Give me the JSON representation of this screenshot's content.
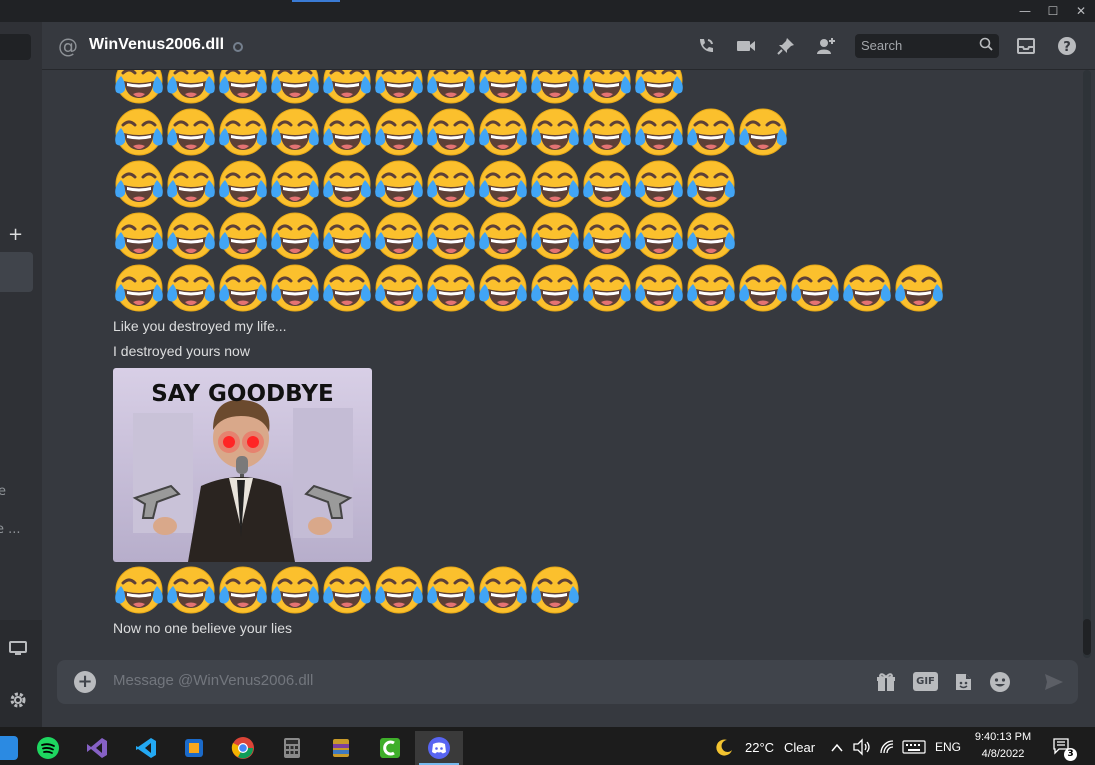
{
  "window": {
    "minimize": "—",
    "maximize": "☐",
    "close": "✕"
  },
  "sidebar": {
    "add_icon": "+",
    "partial_text_1": "e",
    "partial_text_2": "e ...",
    "screen_icon": "screen-share-icon",
    "settings_icon": "gear-icon"
  },
  "header": {
    "at_symbol": "@",
    "channel_name": "WinVenus2006.dll",
    "status": "offline",
    "search_placeholder": "Search",
    "icons": [
      "call-icon",
      "video-icon",
      "pin-icon",
      "add-friend-icon",
      "inbox-icon",
      "help-icon"
    ]
  },
  "messages": {
    "partial_top_row_count": 11,
    "row1_count": 13,
    "row2_count": 12,
    "row3_count": 12,
    "row4_count": 16,
    "text1": "Like you destroyed my life...",
    "text2": "I destroyed yours now",
    "meme_caption": "SAY GOODBYE",
    "row5_count": 9,
    "text3": "Now no one believe your lies",
    "emoji": "face-with-tears-of-joy"
  },
  "composer": {
    "placeholder": "Message @WinVenus2006.dll",
    "gif_label": "GIF",
    "icons": [
      "add-attachment-icon",
      "gift-icon",
      "gif-icon",
      "sticker-icon",
      "emoji-icon",
      "send-icon"
    ]
  },
  "taskbar": {
    "apps": [
      "start",
      "spotify",
      "visual-studio",
      "vs-code",
      "virtualbox",
      "chrome",
      "calculator",
      "winrar",
      "camtasia",
      "discord"
    ],
    "weather_temp": "22°C",
    "weather_desc": "Clear",
    "language": "ENG",
    "time": "9:40:13 PM",
    "date": "4/8/2022",
    "notification_count": "3",
    "colors": {
      "active_underline": "#76b9ed",
      "discord": "#5865f2"
    }
  }
}
